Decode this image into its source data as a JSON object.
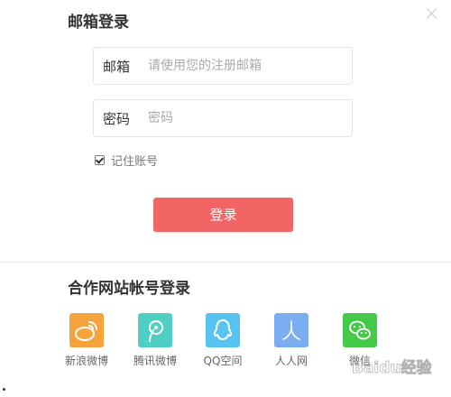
{
  "dialog": {
    "title": "邮箱登录",
    "email": {
      "label": "邮箱",
      "placeholder": "请使用您的注册邮箱",
      "value": ""
    },
    "password": {
      "label": "密码",
      "placeholder": "密码",
      "value": ""
    },
    "remember": {
      "label": "记住账号",
      "checked": true
    },
    "login_button": "登录",
    "partner_title": "合作网站帐号登录",
    "partners": [
      {
        "name": "新浪微博",
        "color": "#f5a33a",
        "icon": "sina-weibo-icon"
      },
      {
        "name": "腾讯微博",
        "color": "#4fcfc3",
        "icon": "tencent-weibo-icon"
      },
      {
        "name": "QQ空间",
        "color": "#56c3f0",
        "icon": "qzone-icon"
      },
      {
        "name": "人人网",
        "color": "#7aaef0",
        "icon": "renren-icon"
      },
      {
        "name": "微信",
        "color": "#44c948",
        "icon": "wechat-icon"
      }
    ],
    "accent_color": "#f36565"
  },
  "watermark": "Baidu经验"
}
